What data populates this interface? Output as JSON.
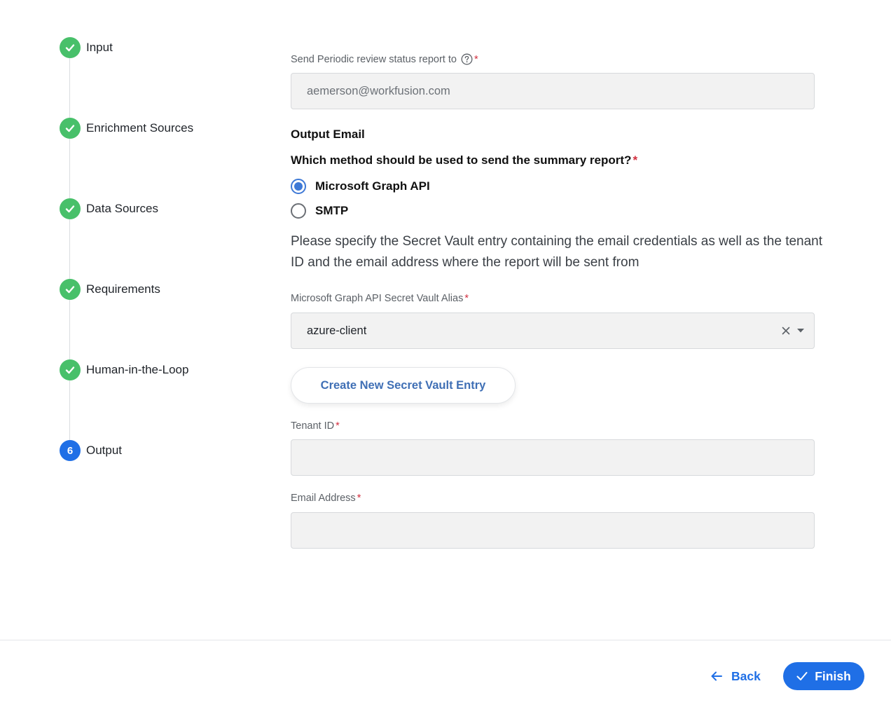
{
  "stepper": {
    "steps": [
      {
        "label": "Input",
        "status": "done"
      },
      {
        "label": "Enrichment Sources",
        "status": "done"
      },
      {
        "label": "Data Sources",
        "status": "done"
      },
      {
        "label": "Requirements",
        "status": "done"
      },
      {
        "label": "Human-in-the-Loop",
        "status": "done"
      },
      {
        "label": "Output",
        "status": "active",
        "number": "6"
      }
    ]
  },
  "form": {
    "report_recipient": {
      "label": "Send Periodic review status report to",
      "required_mark": "*",
      "value": "aemerson@workfusion.com"
    },
    "output_email_heading": "Output Email",
    "method_question": {
      "text": "Which method should be used to send the summary report?",
      "required_mark": "*",
      "options": [
        {
          "label": "Microsoft Graph API",
          "selected": true
        },
        {
          "label": "SMTP",
          "selected": false
        }
      ]
    },
    "description": "Please specify the Secret Vault entry containing the email credentials as well as the tenant ID and the email address where the report will be sent from",
    "vault_alias": {
      "label": "Microsoft Graph API Secret Vault Alias",
      "required_mark": "*",
      "value": "azure-client"
    },
    "create_vault_button": "Create New Secret Vault Entry",
    "tenant_id": {
      "label": "Tenant ID",
      "required_mark": "*",
      "value": ""
    },
    "email_address": {
      "label": "Email Address",
      "required_mark": "*",
      "value": ""
    }
  },
  "footer": {
    "back_label": "Back",
    "finish_label": "Finish"
  },
  "colors": {
    "done_green": "#48c06a",
    "primary_blue": "#1f6fe6",
    "radio_blue": "#3e79d6",
    "required_red": "#d22f3f"
  }
}
